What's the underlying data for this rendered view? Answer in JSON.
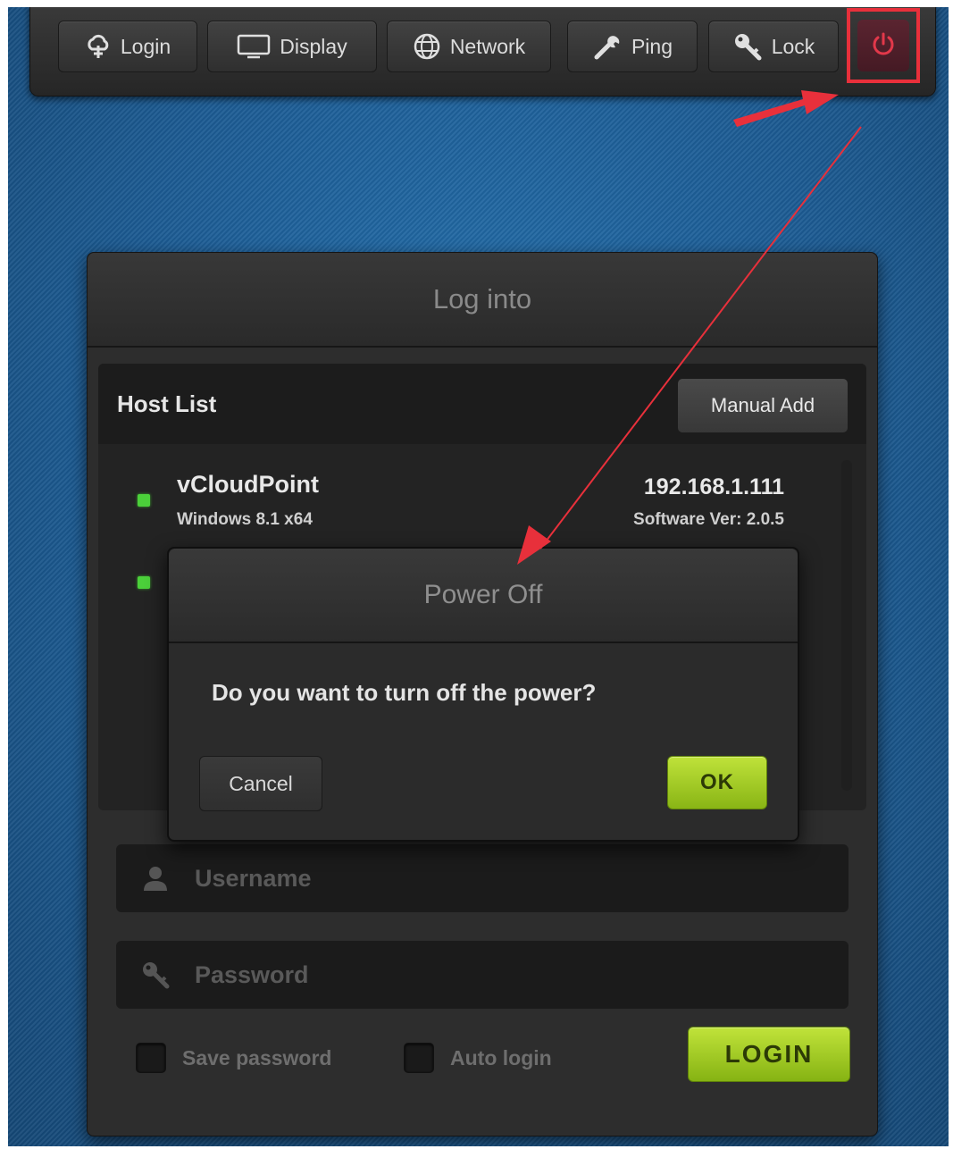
{
  "toolbar": {
    "buttons": [
      {
        "label": "Login",
        "icon": "cloud-icon"
      },
      {
        "label": "Display",
        "icon": "monitor-icon"
      },
      {
        "label": "Network",
        "icon": "globe-icon"
      },
      {
        "label": "Ping",
        "icon": "wrench-icon"
      },
      {
        "label": "Lock",
        "icon": "key-icon"
      }
    ],
    "power_icon": "power-icon"
  },
  "login_panel": {
    "title": "Log into",
    "host_list": {
      "title": "Host List",
      "manual_add_label": "Manual Add",
      "hosts": [
        {
          "name": "vCloudPoint",
          "os": "Windows 8.1 x64",
          "ip": "192.168.1.111",
          "version": "Software Ver: 2.0.5",
          "status": "online"
        },
        {
          "status": "online"
        }
      ]
    },
    "username_placeholder": "Username",
    "password_placeholder": "Password",
    "save_password_label": "Save password",
    "auto_login_label": "Auto login",
    "login_button": "LOGIN"
  },
  "dialog": {
    "title": "Power Off",
    "message": "Do you want to turn off the power?",
    "cancel_label": "Cancel",
    "ok_label": "OK"
  },
  "colors": {
    "background": "#1c5b93",
    "accent_green": "#a3cc25",
    "annotation_red": "#e8303b",
    "status_green": "#4bd03a"
  }
}
